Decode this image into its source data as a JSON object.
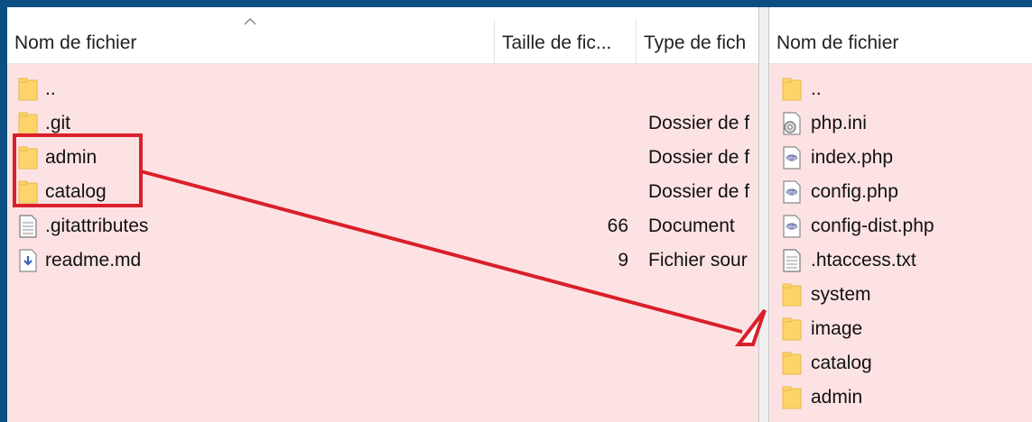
{
  "left_pane": {
    "columns": {
      "name": "Nom de fichier",
      "size": "Taille de fic...",
      "type": "Type de fich"
    },
    "rows": [
      {
        "name": "..",
        "size": "",
        "type": "",
        "icon": "folder-icon"
      },
      {
        "name": ".git",
        "size": "",
        "type": "Dossier de f",
        "icon": "folder-icon"
      },
      {
        "name": "admin",
        "size": "",
        "type": "Dossier de f",
        "icon": "folder-icon"
      },
      {
        "name": "catalog",
        "size": "",
        "type": "Dossier de f",
        "icon": "folder-icon"
      },
      {
        "name": ".gitattributes",
        "size": "66",
        "type": "Document",
        "icon": "text-file-icon"
      },
      {
        "name": "readme.md",
        "size": "9",
        "type": "Fichier sour",
        "icon": "markdown-file-icon"
      }
    ]
  },
  "right_pane": {
    "columns": {
      "name": "Nom de fichier"
    },
    "rows": [
      {
        "name": "..",
        "icon": "folder-icon"
      },
      {
        "name": "php.ini",
        "icon": "settings-file-icon"
      },
      {
        "name": "index.php",
        "icon": "php-file-icon"
      },
      {
        "name": "config.php",
        "icon": "php-file-icon"
      },
      {
        "name": "config-dist.php",
        "icon": "php-file-icon"
      },
      {
        "name": ".htaccess.txt",
        "icon": "text-file-icon"
      },
      {
        "name": "system",
        "icon": "folder-icon"
      },
      {
        "name": "image",
        "icon": "folder-icon"
      },
      {
        "name": "catalog",
        "icon": "folder-icon"
      },
      {
        "name": "admin",
        "icon": "folder-icon"
      }
    ]
  },
  "colors": {
    "background": "#0b4f82",
    "pane_fill": "#fde2e4",
    "annotation": "#d9202a",
    "folder": "#fcd46a"
  }
}
